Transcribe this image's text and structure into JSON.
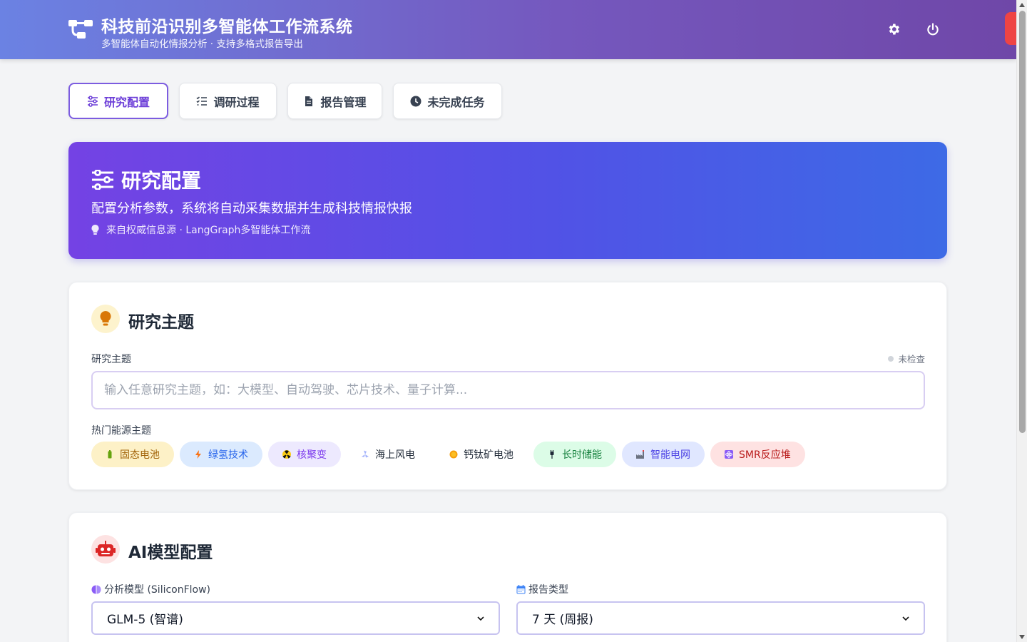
{
  "header": {
    "title": "科技前沿识别多智能体工作流系统",
    "subtitle": "多智能体自动化情报分析 · 支持多格式报告导出"
  },
  "tabs": [
    {
      "label": "研究配置",
      "icon": "sliders-icon",
      "active": true
    },
    {
      "label": "调研过程",
      "icon": "list-check-icon",
      "active": false
    },
    {
      "label": "报告管理",
      "icon": "file-icon",
      "active": false
    },
    {
      "label": "未完成任务",
      "icon": "clock-icon",
      "active": false
    }
  ],
  "banner": {
    "title": "研究配置",
    "description": "配置分析参数，系统将自动采集数据并生成科技情报快报",
    "note": "来自权威信息源 · LangGraph多智能体工作流"
  },
  "topic_card": {
    "title": "研究主题",
    "field_label": "研究主题",
    "status": "未检查",
    "placeholder": "输入任意研究主题，如：大模型、自动驾驶、芯片技术、量子计算...",
    "value": "",
    "hot_label": "热门能源主题",
    "hot_topics": [
      {
        "label": "固态电池",
        "icon": "battery-icon",
        "bg": "#fdf1c7",
        "fg": "#a16207"
      },
      {
        "label": "绿氢技术",
        "icon": "bolt-icon",
        "bg": "#dbeafe",
        "fg": "#2563eb"
      },
      {
        "label": "核聚变",
        "icon": "radiation-icon",
        "bg": "#ede9fe",
        "fg": "#7c3aed"
      },
      {
        "label": "海上风电",
        "icon": "wind-icon",
        "bg": "#ffffff",
        "fg": "#1f2937"
      },
      {
        "label": "钙钛矿电池",
        "icon": "sun-icon",
        "bg": "#ffffff",
        "fg": "#1f2937"
      },
      {
        "label": "长时储能",
        "icon": "plug-icon",
        "bg": "#dcfce7",
        "fg": "#15803d"
      },
      {
        "label": "智能电网",
        "icon": "factory-icon",
        "bg": "#e0e7ff",
        "fg": "#4f46e5"
      },
      {
        "label": "SMR反应堆",
        "icon": "atom-icon",
        "bg": "#fee2e2",
        "fg": "#b91c1c"
      }
    ]
  },
  "model_card": {
    "title": "AI模型配置",
    "model_label": "分析模型 (SiliconFlow)",
    "model_value": "GLM-5 (智谱)",
    "report_label": "报告类型",
    "report_value": "7 天 (周报)"
  },
  "colors": {
    "accent": "#6d3fd8",
    "header_start": "#6b82e3",
    "header_end": "#6f47a8",
    "banner_start": "#7442e4",
    "banner_end": "#3d6ae6"
  }
}
